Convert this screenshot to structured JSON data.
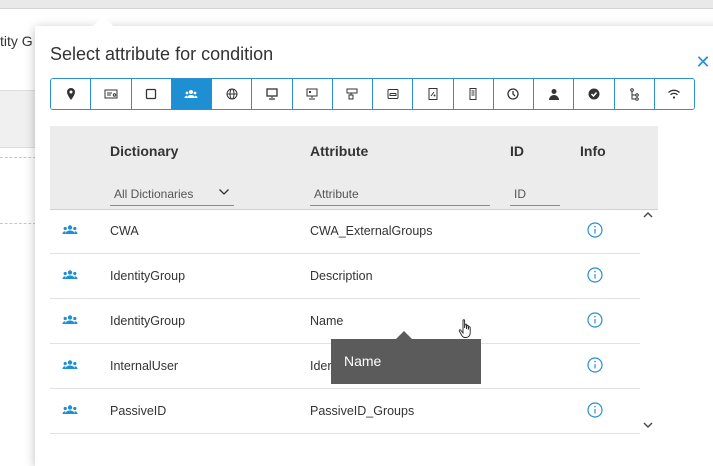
{
  "background": {
    "partial_text": "tity G"
  },
  "dialog": {
    "title": "Select attribute for condition",
    "close_icon": "close-icon",
    "tabs": [
      {
        "icon": "location-pin-icon",
        "active": false
      },
      {
        "icon": "id-card-icon",
        "active": false
      },
      {
        "icon": "square-icon",
        "active": false
      },
      {
        "icon": "user-group-icon",
        "active": true
      },
      {
        "icon": "globe-icon",
        "active": false
      },
      {
        "icon": "desktop-monitor-icon",
        "active": false
      },
      {
        "icon": "monitor-id-icon",
        "active": false
      },
      {
        "icon": "network-device-icon",
        "active": false
      },
      {
        "icon": "inbox-icon",
        "active": false
      },
      {
        "icon": "certificate-icon",
        "active": false
      },
      {
        "icon": "server-icon",
        "active": false
      },
      {
        "icon": "clock-icon",
        "active": false
      },
      {
        "icon": "user-icon",
        "active": false
      },
      {
        "icon": "check-badge-icon",
        "active": false
      },
      {
        "icon": "hierarchy-icon",
        "active": false
      },
      {
        "icon": "wifi-icon",
        "active": false
      }
    ],
    "active_color": "#1f8fd3",
    "table": {
      "headers": {
        "dictionary": "Dictionary",
        "attribute": "Attribute",
        "id": "ID",
        "info": "Info"
      },
      "filters": {
        "dictionary_value": "All Dictionaries",
        "attribute_placeholder": "Attribute",
        "id_placeholder": "ID"
      },
      "rows": [
        {
          "dictionary": "CWA",
          "attribute": "CWA_ExternalGroups",
          "icon": "user-group-icon",
          "info_icon": "info-icon"
        },
        {
          "dictionary": "IdentityGroup",
          "attribute": "Description",
          "icon": "user-group-icon",
          "info_icon": "info-icon"
        },
        {
          "dictionary": "IdentityGroup",
          "attribute": "Name",
          "icon": "user-group-icon",
          "info_icon": "info-icon"
        },
        {
          "dictionary": "InternalUser",
          "attribute": "Ider",
          "icon": "user-group-icon",
          "info_icon": "info-icon"
        },
        {
          "dictionary": "PassiveID",
          "attribute": "PassiveID_Groups",
          "icon": "user-group-icon",
          "info_icon": "info-icon"
        }
      ]
    },
    "tooltip": {
      "text": "Name"
    }
  }
}
